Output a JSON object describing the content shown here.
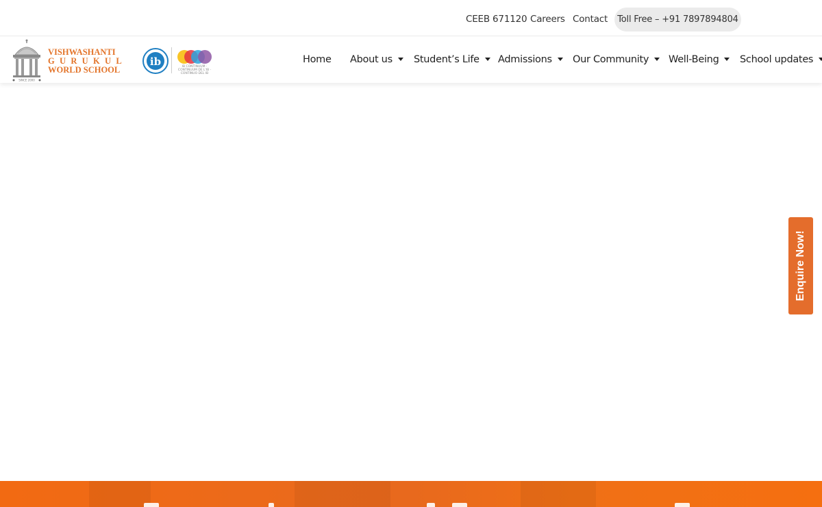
{
  "topbar": {
    "ceeb": "CEEB 671120",
    "careers": "Careers",
    "contact": "Contact",
    "toll_free": "Toll Free – +91 7897894804"
  },
  "logo": {
    "line1": "VISHWASHANTI",
    "line2": "GURUKUL",
    "line3": "WORLD SCHOOL",
    "since": "SINCE 2000",
    "ib_tagline": "IB CONTINUUM · CONTINUUM DE L'IB · CONTINUO DEL IB"
  },
  "nav": {
    "items": [
      {
        "label": "Home",
        "dropdown": false
      },
      {
        "label": "About us",
        "dropdown": true
      },
      {
        "label": "Student’s Life",
        "dropdown": true
      },
      {
        "label": "Admissions",
        "dropdown": true
      },
      {
        "label": "Our Community",
        "dropdown": true
      },
      {
        "label": "Well-Being",
        "dropdown": true
      },
      {
        "label": "School updates",
        "dropdown": true
      }
    ]
  },
  "enquire": {
    "label": "Enquire Now!"
  },
  "colors": {
    "brand_orange": "#e46d2c",
    "band_orange": "#f26a12",
    "pill_bg": "#ebebeb"
  }
}
